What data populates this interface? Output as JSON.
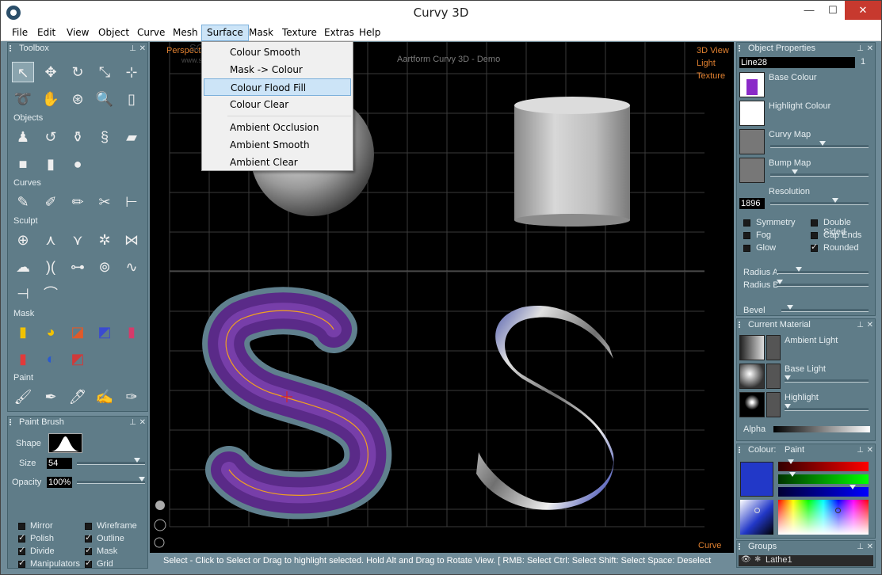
{
  "window": {
    "title": "Curvy 3D",
    "minimize": "—",
    "maximize": "☐",
    "close": "✕"
  },
  "menu": [
    "File",
    "Edit",
    "View",
    "Object",
    "Curve",
    "Mesh",
    "Surface",
    "Mask",
    "Texture",
    "Extras",
    "Help"
  ],
  "surface_menu": {
    "items": [
      "Colour Smooth",
      "Mask -> Colour",
      "Colour Flood Fill",
      "Colour Clear",
      "Ambient Occlusion",
      "Ambient Smooth",
      "Ambient Clear"
    ],
    "highlighted": "Colour Flood Fill"
  },
  "toolbox": {
    "title": "Toolbox",
    "sections": {
      "objects": "Objects",
      "curves": "Curves",
      "sculpt": "Sculpt",
      "mask": "Mask",
      "paint": "Paint"
    }
  },
  "paint_brush": {
    "title": "Paint Brush",
    "shape_label": "Shape",
    "size_label": "Size",
    "size_value": "54",
    "size_level": 0.92,
    "opacity_label": "Opacity",
    "opacity_value": "100%",
    "opacity_level": 1.0,
    "checks": [
      {
        "label": "Mirror",
        "on": false
      },
      {
        "label": "Wireframe",
        "on": false
      },
      {
        "label": "Polish",
        "on": true
      },
      {
        "label": "Outline",
        "on": true
      },
      {
        "label": "Divide",
        "on": true
      },
      {
        "label": "Mask",
        "on": true
      },
      {
        "label": "Manipulators",
        "on": true
      },
      {
        "label": "Grid",
        "on": true
      }
    ]
  },
  "viewport": {
    "perspective": "Perspective",
    "demo_title": "Aartform Curvy 3D - Demo",
    "watermark": "SOFTPEDIA",
    "watermark_url": "www.softpedia.com",
    "modes": [
      "3D View",
      "Light",
      "Texture"
    ],
    "mode_bottom": "Curve"
  },
  "status_text": "Select - Click to Select or Drag to highlight selected. Hold Alt and Drag to Rotate View. [ RMB: Select   Ctrl: Select   Shift: Select   Space: Deselect",
  "object_properties": {
    "title": "Object Properties",
    "object_name": "Line28",
    "object_index": "1",
    "maps": [
      "Base Colour",
      "Highlight Colour",
      "Curvy Map",
      "Bump Map"
    ],
    "resolution_label": "Resolution",
    "resolution_value": "1896",
    "options": [
      {
        "label": "Symmetry",
        "on": false
      },
      {
        "label": "Double Sided",
        "on": false
      },
      {
        "label": "Fog",
        "on": false
      },
      {
        "label": "Cap Ends",
        "on": false
      },
      {
        "label": "Glow",
        "on": false
      },
      {
        "label": "Rounded",
        "on": true
      }
    ],
    "radius_a": "Radius A",
    "radius_b": "Radius B",
    "bevel": "Bevel"
  },
  "current_material": {
    "title": "Current Material",
    "rows": [
      "Ambient Light",
      "Base Light",
      "Highlight"
    ],
    "alpha_label": "Alpha"
  },
  "colour": {
    "title": "Colour:",
    "mode": "Paint",
    "swatch": "#2238c8",
    "rgb_levels": [
      0.11,
      0.13,
      0.85
    ]
  },
  "groups": {
    "title": "Groups",
    "item": "Lathe1"
  }
}
